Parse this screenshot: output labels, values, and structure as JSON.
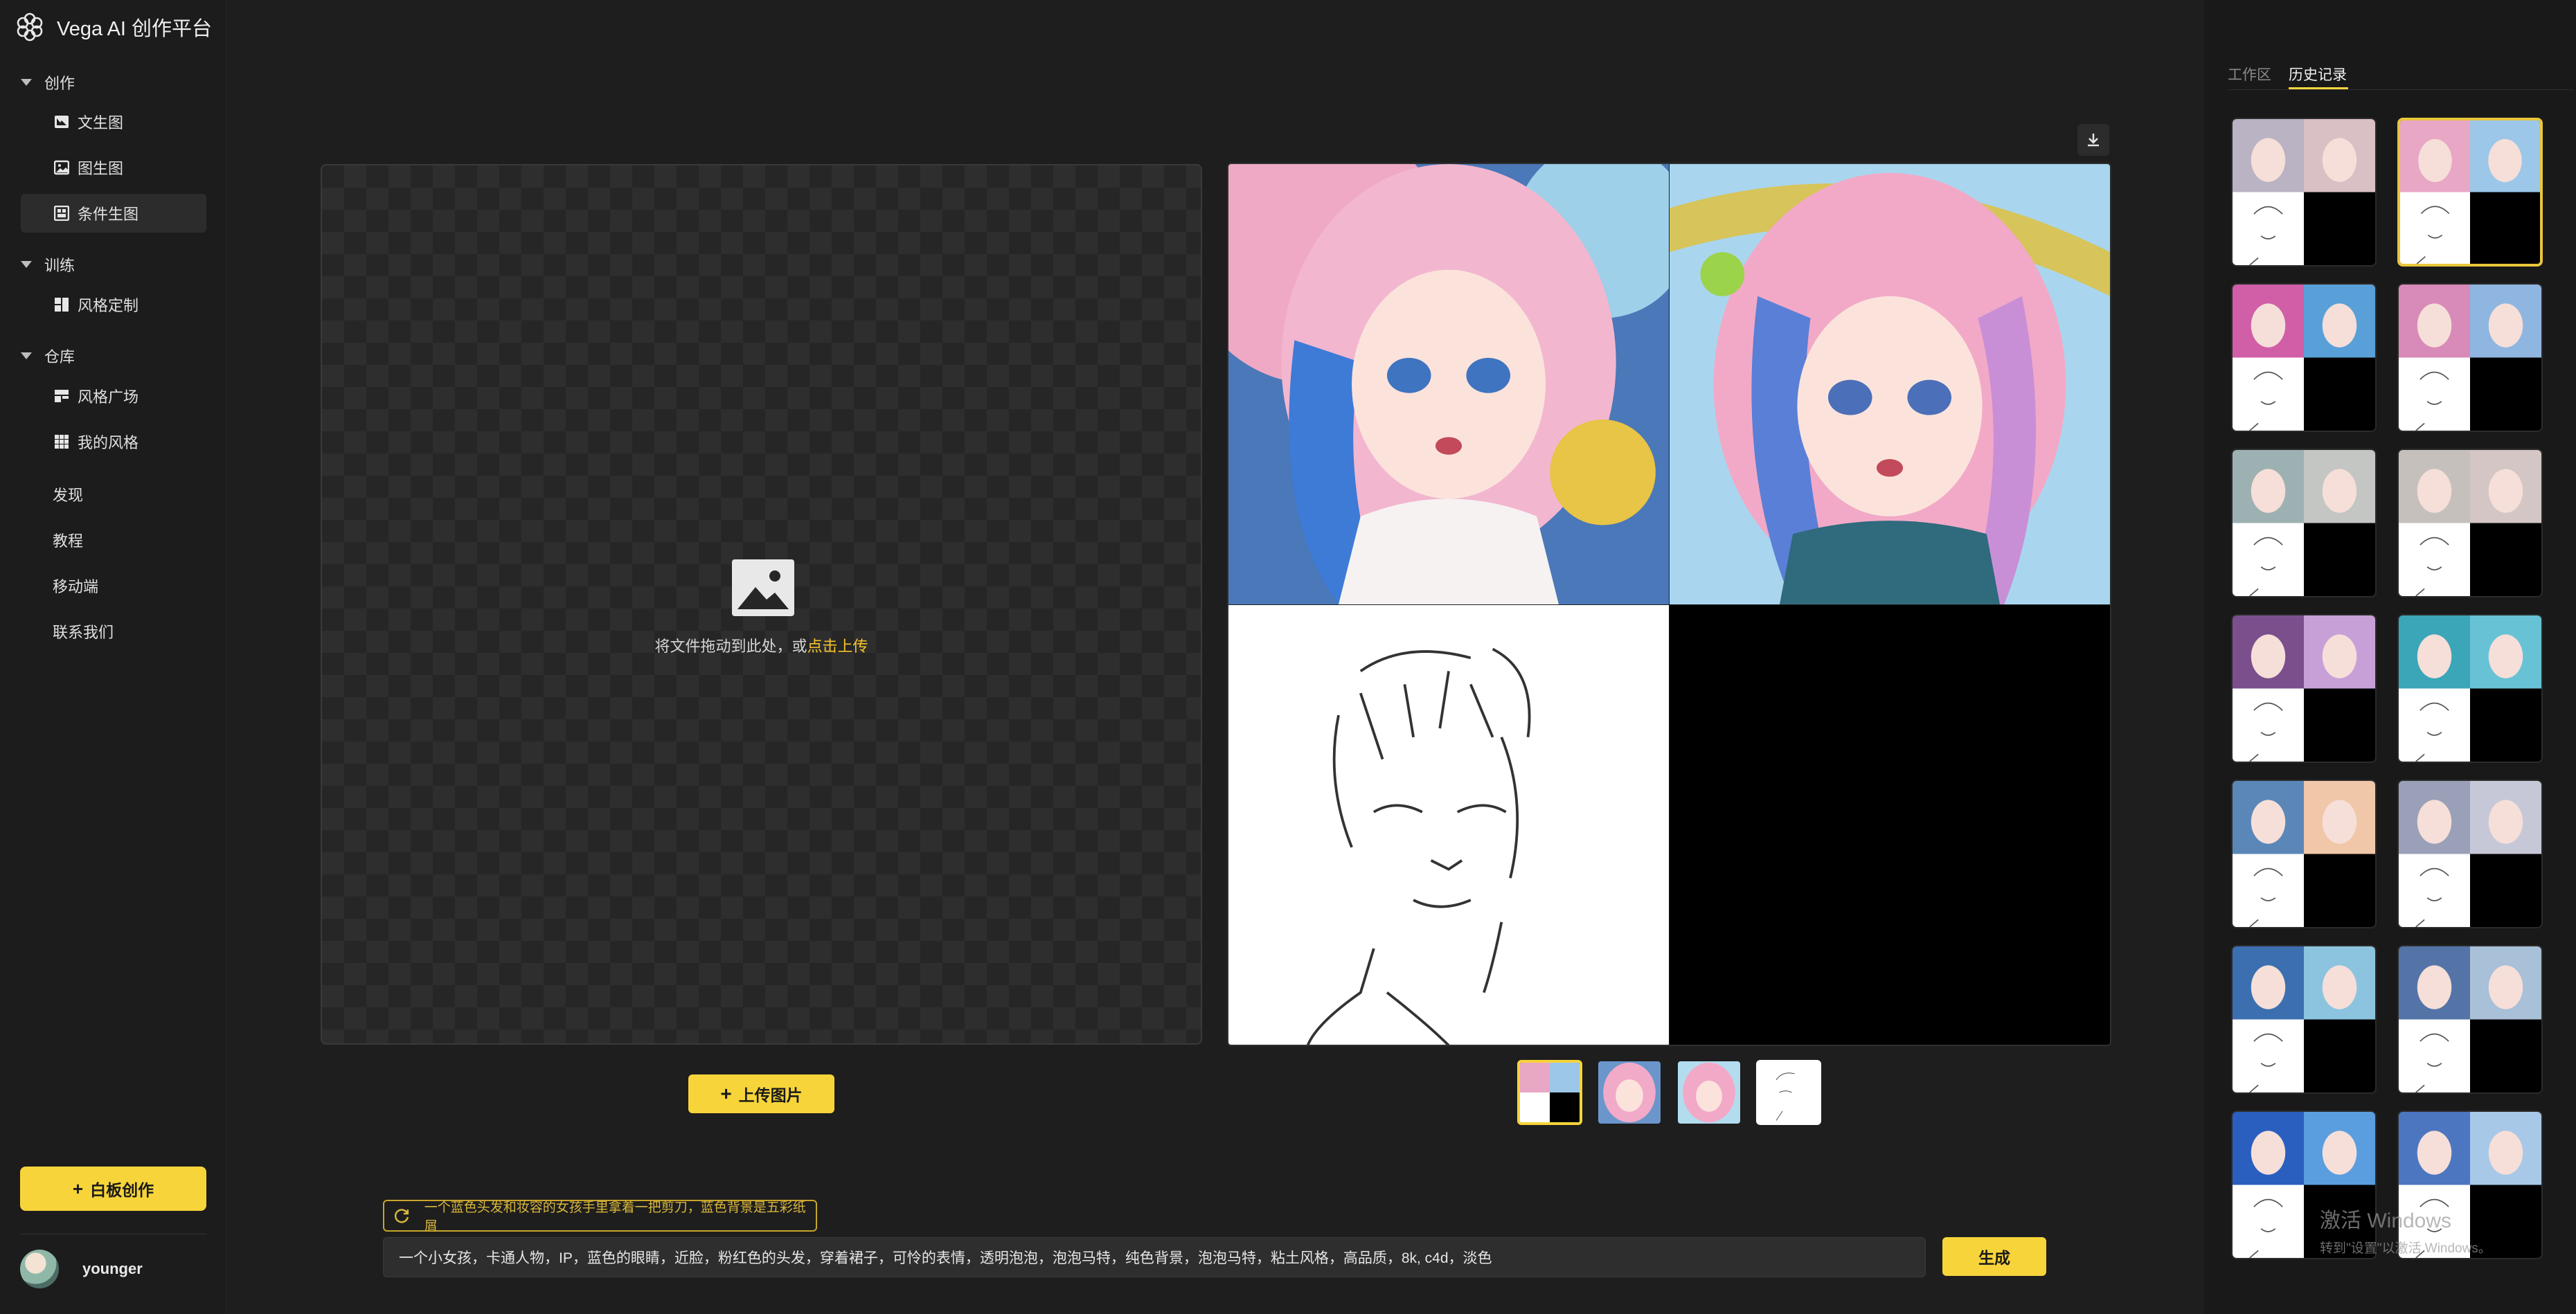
{
  "app": {
    "title": "Vega AI 创作平台"
  },
  "sidebar": {
    "groups": [
      {
        "label": "创作",
        "items": [
          {
            "label": "文生图",
            "icon": "image-frame-icon"
          },
          {
            "label": "图生图",
            "icon": "image-icon"
          },
          {
            "label": "条件生图",
            "icon": "grid-condition-icon",
            "active": true
          }
        ]
      },
      {
        "label": "训练",
        "items": [
          {
            "label": "风格定制",
            "icon": "style-custom-icon"
          }
        ]
      },
      {
        "label": "仓库",
        "items": [
          {
            "label": "风格广场",
            "icon": "style-plaza-icon"
          },
          {
            "label": "我的风格",
            "icon": "my-style-icon"
          }
        ]
      }
    ],
    "links": [
      "发现",
      "教程",
      "移动端",
      "联系我们"
    ],
    "whiteboard_button": "白板创作",
    "user": {
      "name": "younger"
    }
  },
  "topbar": {
    "icons": [
      "settings-hex-icon",
      "bell-icon",
      "headset-icon"
    ]
  },
  "upload": {
    "hint_prefix": "将文件拖动到此处，或",
    "hint_link": "点击上传",
    "button": "上传图片"
  },
  "results": {
    "thumb_count": 4,
    "selected_thumb": 0
  },
  "prompt": {
    "suggestion": "一个蓝色头发和妆容的女孩手里拿着一把剪刀，蓝色背景是五彩纸屑",
    "value": "一个小女孩，卡通人物，IP，蓝色的眼睛，近脸，粉红色的头发，穿着裙子，可怜的表情，透明泡泡，泡泡马特，纯色背景，泡泡马特，粘土风格，高品质，8k, c4d，淡色",
    "generate_button": "生成"
  },
  "history_panel": {
    "tabs": [
      "工作区",
      "历史记录"
    ],
    "active_tab": 1,
    "cards": 14,
    "selected_card": 1
  },
  "watermark": {
    "line1": "激活 Windows",
    "line2": "转到\"设置\"以激活 Windows。"
  },
  "colors": {
    "accent": "#f7d43a",
    "background": "#1e1e1e",
    "panel": "#191919"
  }
}
